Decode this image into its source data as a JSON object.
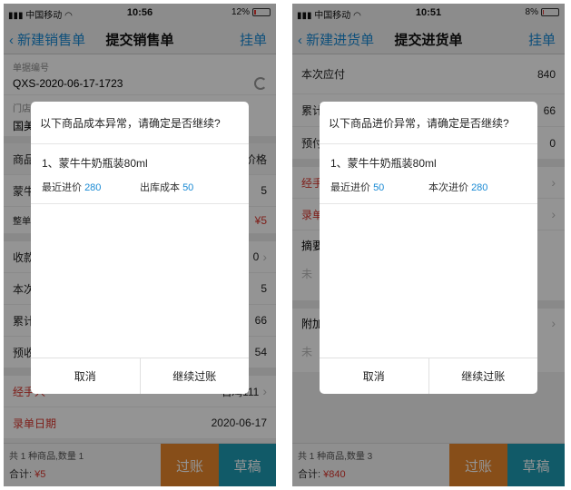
{
  "status_left": {
    "carrier": "中国移动",
    "time": "10:56",
    "battery": "12%",
    "battery_level": 0.12
  },
  "status_right": {
    "carrier": "中国移动",
    "time": "10:51",
    "battery": "8%",
    "battery_level": 0.08
  },
  "left": {
    "nav": {
      "back": "新建销售单",
      "title": "提交销售单",
      "right": "挂单"
    },
    "doc_no_label": "单据编号",
    "doc_no": "QXS-2020-06-17-1723",
    "store_label": "门店",
    "store": "国美",
    "col_goods": "商品",
    "col_price": "价格",
    "goods": "蒙牛",
    "qty": "5",
    "whole": "整单",
    "whole_amount": "¥5",
    "receive_label": "收款",
    "receive_val": "0",
    "current_label": "本次",
    "current_val": "5",
    "accum_label": "累计",
    "accum_val": "66",
    "prepay_label": "预收",
    "prepay_val": "54",
    "handler_label": "经手人*",
    "handler": "石鸡111",
    "entry_label": "录单日期",
    "entry_val": "2020-06-17",
    "summary": "共 1 种商品,数量 1",
    "total_label": "合计:",
    "total": "¥5",
    "post": "过账",
    "draft": "草稿",
    "dialog": {
      "title": "以下商品成本异常，请确定是否继续?",
      "item": "1、蒙牛牛奶瓶装80ml",
      "p1_label": "最近进价",
      "p1": "280",
      "p2_label": "出库成本",
      "p2": "50",
      "cancel": "取消",
      "confirm": "继续过账"
    }
  },
  "right": {
    "nav": {
      "back": "新建进货单",
      "title": "提交进货单",
      "right": "挂单"
    },
    "due_label": "本次应付",
    "due": "840",
    "accum_label": "累计",
    "accum_val": "66",
    "prepay_label": "预付",
    "prepay_val": "0",
    "handler_label": "经手人",
    "entry_label": "录单",
    "memo_label": "摘要",
    "memo_placeholder": "未",
    "attach_label": "附加",
    "attach_placeholder": "未",
    "summary": "共 1 种商品,数量 3",
    "total_label": "合计:",
    "total": "¥840",
    "post": "过账",
    "draft": "草稿",
    "dialog": {
      "title": "以下商品进价异常，请确定是否继续?",
      "item": "1、蒙牛牛奶瓶装80ml",
      "p1_label": "最近进价",
      "p1": "50",
      "p2_label": "本次进价",
      "p2": "280",
      "cancel": "取消",
      "confirm": "继续过账"
    }
  }
}
